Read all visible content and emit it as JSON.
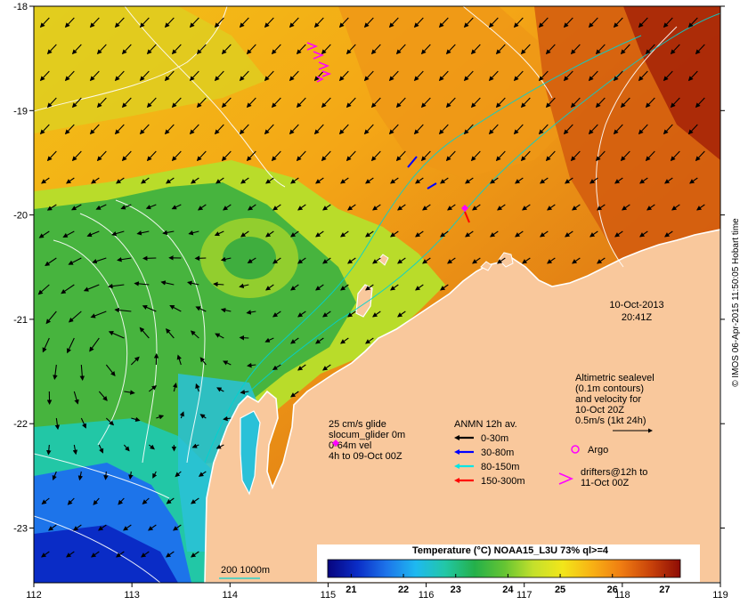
{
  "date_stamp": {
    "date": "10-Oct-2013",
    "time": "20:41Z"
  },
  "credit": "© IMOS 06-Apr-2015 11:50:05 Hobart time",
  "x_ticks": [
    "112",
    "113",
    "114",
    "115",
    "116",
    "117",
    "118",
    "119"
  ],
  "y_ticks": [
    "-18",
    "-19",
    "-20",
    "-21",
    "-22",
    "-23"
  ],
  "altimetry_note": {
    "lines": [
      "Altimetric sealevel",
      "(0.1m contours)",
      "and velocity for",
      "10-Oct 20Z",
      "0.5m/s (1kt 24h)"
    ]
  },
  "glider_note": {
    "lines": [
      "25 cm/s glide",
      "slocum_glider 0m",
      "0-64m vel",
      "4h to 09-Oct 00Z"
    ]
  },
  "anmn_legend": {
    "title": "ANMN 12h av.",
    "items": [
      {
        "label": "0-30m",
        "color": "#000000"
      },
      {
        "label": "30-80m",
        "color": "#0000ff"
      },
      {
        "label": "80-150m",
        "color": "#00e6e6"
      },
      {
        "label": "150-300m",
        "color": "#ff0000"
      }
    ]
  },
  "argo_label": "Argo",
  "drifters_note": {
    "lines": [
      "drifters@12h to",
      "11-Oct 00Z"
    ]
  },
  "isobath_label": "200  1000m",
  "colorbar": {
    "title": "Temperature (°C) NOAA15_L3U 73% ql>=4",
    "ticks": [
      "21",
      "22",
      "23",
      "24",
      "25",
      "26",
      "27"
    ],
    "colors": [
      "#07047e",
      "#0a2cc6",
      "#1d74ea",
      "#1eb9f0",
      "#22c7a6",
      "#24b04a",
      "#64c433",
      "#c4e02c",
      "#f2e61a",
      "#f8b114",
      "#ef7c12",
      "#c8420a",
      "#8e0c05"
    ]
  },
  "accent_colors": {
    "land": "#f9c89c",
    "coast": "#ffffff",
    "glider": "#ff00ff",
    "isobath": "#00c8c8"
  }
}
